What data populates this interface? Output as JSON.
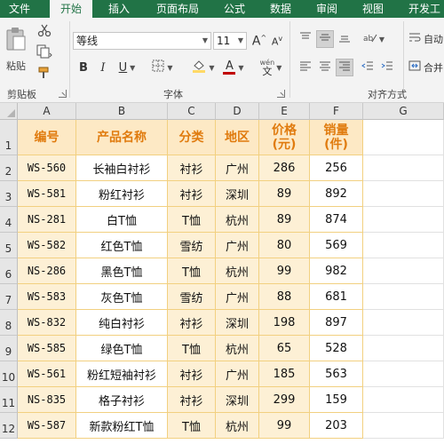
{
  "ribbon_tabs": [
    {
      "label": "文件",
      "active": false
    },
    {
      "label": "开始",
      "active": true
    },
    {
      "label": "插入",
      "active": false
    },
    {
      "label": "页面布局",
      "active": false
    },
    {
      "label": "公式",
      "active": false
    },
    {
      "label": "数据",
      "active": false
    },
    {
      "label": "审阅",
      "active": false
    },
    {
      "label": "视图",
      "active": false
    },
    {
      "label": "开发工",
      "active": false
    }
  ],
  "clipboard": {
    "paste_label": "粘贴",
    "group_label": "剪贴板"
  },
  "font": {
    "name": "等线",
    "size": "11",
    "bold": "B",
    "italic": "I",
    "underline": "U",
    "grow": "A",
    "shrink": "A",
    "font_color_glyph": "A",
    "fill_color": "#ffd966",
    "font_color": "#c00000",
    "wen_glyph": "wén",
    "wen_char": "文",
    "group_label": "字体"
  },
  "alignment": {
    "group_label": "对齐方式",
    "wrap_label": "自动",
    "merge_label": "合并"
  },
  "sheet": {
    "columns": [
      "A",
      "B",
      "C",
      "D",
      "E",
      "F",
      "G"
    ],
    "rows": [
      "1",
      "2",
      "3",
      "4",
      "5",
      "6",
      "7",
      "8",
      "9",
      "10",
      "11",
      "12"
    ],
    "header": [
      "编号",
      "产品名称",
      "分类",
      "地区",
      "价格\n(元)",
      "销量\n(件)"
    ],
    "data": [
      [
        "WS-560",
        "长袖白衬衫",
        "衬衫",
        "广州",
        "286",
        "256"
      ],
      [
        "WS-581",
        "粉红衬衫",
        "衬衫",
        "深圳",
        "89",
        "892"
      ],
      [
        "NS-281",
        "白T恤",
        "T恤",
        "杭州",
        "89",
        "874"
      ],
      [
        "WS-582",
        "红色T恤",
        "雪纺",
        "广州",
        "80",
        "569"
      ],
      [
        "NS-286",
        "黑色T恤",
        "T恤",
        "杭州",
        "99",
        "982"
      ],
      [
        "WS-583",
        "灰色T恤",
        "雪纺",
        "广州",
        "88",
        "681"
      ],
      [
        "WS-832",
        "纯白衬衫",
        "衬衫",
        "深圳",
        "198",
        "897"
      ],
      [
        "WS-585",
        "绿色T恤",
        "T恤",
        "杭州",
        "65",
        "528"
      ],
      [
        "WS-561",
        "粉红短袖衬衫",
        "衬衫",
        "广州",
        "185",
        "563"
      ],
      [
        "NS-835",
        "格子衬衫",
        "衬衫",
        "深圳",
        "299",
        "159"
      ],
      [
        "WS-587",
        "新款粉红T恤",
        "T恤",
        "杭州",
        "99",
        "203"
      ]
    ],
    "colors": {
      "header_fill": "#fde9c5",
      "header_text": "#e07b0e",
      "body_fill": "#fdf0d5",
      "border": "#f2d080"
    }
  }
}
